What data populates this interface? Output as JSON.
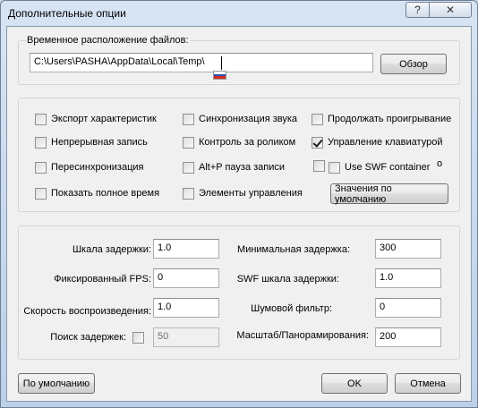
{
  "window": {
    "title": "Дополнительные опции",
    "help_label": "?",
    "close_label": "✕"
  },
  "file_location": {
    "group_label": "Временное расположение файлов:",
    "path_value": "C:\\Users\\PASHA\\AppData\\Local\\Temp\\",
    "browse_label": "Обзор"
  },
  "options": {
    "export_stats": {
      "label": "Экспорт характеристик",
      "checked": false
    },
    "continuous_record": {
      "label": "Непрерывная запись",
      "checked": false
    },
    "resync": {
      "label": "Пересинхронизация",
      "checked": false
    },
    "show_full_time": {
      "label": "Показать полное время",
      "checked": false
    },
    "sound_sync": {
      "label": "Синхронизация звука",
      "checked": false
    },
    "roller_control": {
      "label": "Контроль за роликом",
      "checked": false
    },
    "altp_pause": {
      "label": "Alt+P пауза записи",
      "checked": false
    },
    "controls": {
      "label": "Элементы управления",
      "checked": false
    },
    "continue_play": {
      "label": "Продолжать проигрывание",
      "checked": false
    },
    "keyboard_control": {
      "label": "Управление клавиатурой",
      "checked": true
    },
    "extra_checkbox": {
      "label": "",
      "checked": false
    },
    "use_swf_container": {
      "label": "Use SWF container",
      "checked": false
    },
    "defaults_values_label": "Значения по умолчанию"
  },
  "params": {
    "delay_scale": {
      "label": "Шкала задержки:",
      "value": "1.0"
    },
    "fixed_fps": {
      "label": "Фиксированный FPS:",
      "value": "0"
    },
    "playback_speed": {
      "label": "Скорость воспроизведения:",
      "value": "1.0"
    },
    "delay_search": {
      "label": "Поиск задержек:",
      "value": "50",
      "checked": false
    },
    "min_delay": {
      "label": "Минимальная задержка:",
      "value": "300"
    },
    "swf_delay_scale": {
      "label": "SWF шкала задержки:",
      "value": "1.0"
    },
    "noise_filter": {
      "label": "Шумовой фильтр:",
      "value": "0"
    },
    "zoom_pan": {
      "label": "Масштаб/Панорамирования:",
      "value": "200"
    }
  },
  "footer": {
    "defaults_label": "По умолчанию",
    "ok_label": "OK",
    "cancel_label": "Отмена"
  },
  "colors": {
    "titlebar": "#c9d8ea",
    "client_bg": "#f0f0f0"
  },
  "icons": {
    "flag": "russian-flag-icon"
  }
}
